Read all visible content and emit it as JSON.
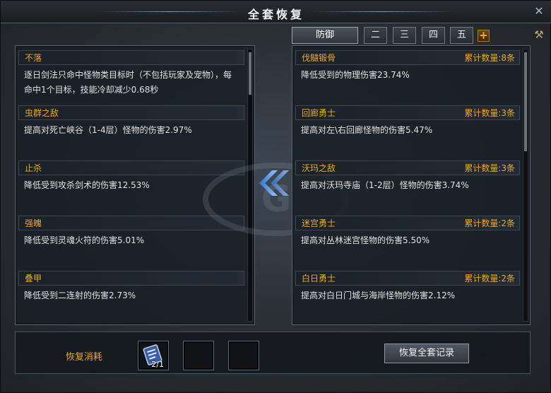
{
  "window": {
    "title": "全套恢复"
  },
  "tabs": [
    {
      "label": "防御",
      "active": true
    },
    {
      "label": "二",
      "active": false
    },
    {
      "label": "三",
      "active": false
    },
    {
      "label": "四",
      "active": false
    },
    {
      "label": "五",
      "active": false
    }
  ],
  "plus_label": "+",
  "left_entries": [
    {
      "title": "不落",
      "desc": "逐日剑法只命中怪物类目标时（不包括玩家及宠物），每命中1个目标，技能冷却减少0.68秒"
    },
    {
      "title": "虫群之敌",
      "desc": "提高对死亡峡谷（1-4层）怪物的伤害2.97%"
    },
    {
      "title": "止杀",
      "desc": "降低受到攻杀剑术的伤害12.53%"
    },
    {
      "title": "强魄",
      "desc": "降低受到灵魂火符的伤害5.01%"
    },
    {
      "title": "叠甲",
      "desc": "降低受到二连射的伤害2.73%"
    }
  ],
  "right_entries": [
    {
      "title": "伐髓锻骨",
      "count": "累计数量:8条",
      "desc": "降低受到的物理伤害23.74%"
    },
    {
      "title": "回廊勇士",
      "count": "累计数量:3条",
      "desc": "提高对左\\右回廊怪物的伤害5.47%"
    },
    {
      "title": "沃玛之敌",
      "count": "累计数量:3条",
      "desc": "提高对沃玛寺庙（1-2层）怪物的伤害3.74%"
    },
    {
      "title": "迷宫勇士",
      "count": "累计数量:2条",
      "desc": "提高对丛林迷宫怪物的伤害5.50%"
    },
    {
      "title": "白日勇士",
      "count": "累计数量:2条",
      "desc": "提高对白日门城与海岸怪物的伤害2.12%"
    }
  ],
  "bottom": {
    "cost_label": "恢复消耗",
    "slot_count": "2/1",
    "restore_button": "恢复全套记录"
  },
  "icons": {
    "close": "close-icon",
    "tool": "wrench-icon",
    "arrows": "double-arrow-left-icon",
    "item": "scroll-item-icon"
  },
  "colors": {
    "accent": "#e7a830",
    "text": "#e2e2e2",
    "arrow": "#5a9de8"
  }
}
